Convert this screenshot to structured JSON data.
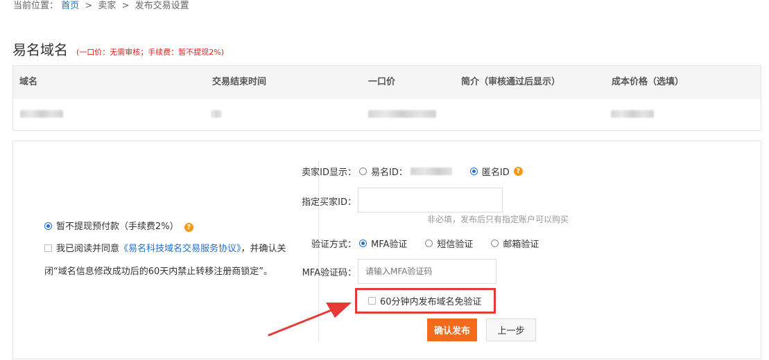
{
  "breadcrumb": {
    "prefix": "当前位置：",
    "home": "首页",
    "sep": ">",
    "seller": "卖家",
    "current": "发布交易设置"
  },
  "header": {
    "title": "易名域名",
    "note": "(一口价：无需审核；手续费：暂不提现2%)"
  },
  "table": {
    "columns": [
      "域名",
      "交易结束时间",
      "一口价",
      "简介（审核通过后显示）",
      "成本价格（选填）"
    ]
  },
  "left": {
    "withdraw_label": "暂不提现预付款（手续费2%）",
    "help": "?",
    "agree_prefix": "我已阅读并同意",
    "agree_link": "《易名科技域名交易服务协议》",
    "agree_suffix": "，并确认关闭“域名信息修改成功后的60天内禁止转移注册商锁定”。"
  },
  "form": {
    "seller_id_label": "卖家ID显示：",
    "seller_id_options": [
      "易名ID：",
      "匿名ID"
    ],
    "buyer_id_label": "指定买家ID：",
    "buyer_id_hint": "非必填，发布后只有指定账户可以购买",
    "verify_label": "验证方式：",
    "verify_options": [
      "MFA验证",
      "短信验证",
      "邮箱验证"
    ],
    "mfa_label": "MFA验证码：",
    "mfa_placeholder": "请输入MFA验证码",
    "skip_verify_label": "60分钟内发布域名免验证",
    "confirm_button": "确认发布",
    "back_button": "上一步"
  },
  "colors": {
    "accent": "#f26a1b",
    "link": "#1f6fd2",
    "highlight": "#e53935"
  }
}
